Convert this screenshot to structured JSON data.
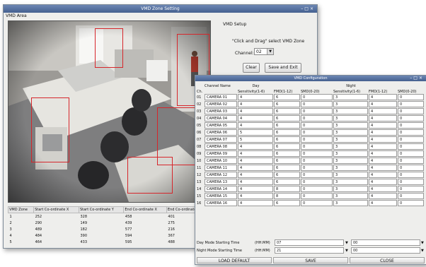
{
  "zone_window": {
    "title": "VMD Zone Setting",
    "menu": "VMD Area",
    "setup": {
      "group_title": "VMD Setup",
      "hint": "\"Click and Drag\" select VMD Zone",
      "channel_label": "Channel:",
      "channel_value": "02",
      "clear_label": "Clear",
      "save_exit_label": "Save and Exit"
    },
    "zone_table": {
      "headers": [
        "VMD Zone",
        "Start Co-ordinate X",
        "Start Co-ordinate Y",
        "End Co-ordinate X",
        "End Co-ordinate Y"
      ],
      "rows": [
        [
          "1",
          "252",
          "328",
          "458",
          "401"
        ],
        [
          "2",
          "290",
          "149",
          "439",
          "275"
        ],
        [
          "3",
          "489",
          "182",
          "577",
          "216"
        ],
        [
          "4",
          "484",
          "390",
          "594",
          "367"
        ],
        [
          "5",
          "464",
          "433",
          "595",
          "488"
        ]
      ]
    }
  },
  "config_window": {
    "title": "VMD Configuration",
    "headers": {
      "ch": "Ch.",
      "channel_name": "Channel Name",
      "day": "Day",
      "night": "Night",
      "day_sens": "Sensitivity(1-6)",
      "day_fmd": "FMD(1-12)",
      "day_smd": "SMD(0-20)",
      "night_sens": "Sensitivity(1-6)",
      "night_fmd": "FMD(1-12)",
      "night_smd": "SMD(0-20)"
    },
    "rows": [
      [
        "01",
        "CAMERA 01",
        "4",
        "6",
        "0",
        "3",
        "4",
        "0"
      ],
      [
        "02",
        "CAMERA 02",
        "4",
        "6",
        "0",
        "3",
        "4",
        "0"
      ],
      [
        "03",
        "CAMERA 03",
        "4",
        "6",
        "0",
        "3",
        "4",
        "0"
      ],
      [
        "04",
        "CAMERA 04",
        "4",
        "6",
        "0",
        "3",
        "4",
        "0"
      ],
      [
        "05",
        "CAMERA 05",
        "4",
        "6",
        "0",
        "3",
        "4",
        "0"
      ],
      [
        "06",
        "CAMERA 06",
        "5",
        "6",
        "0",
        "3",
        "4",
        "0"
      ],
      [
        "07",
        "CAMERA 07",
        "5",
        "6",
        "0",
        "3",
        "4",
        "0"
      ],
      [
        "08",
        "CAMERA 08",
        "4",
        "6",
        "0",
        "3",
        "4",
        "0"
      ],
      [
        "09",
        "CAMERA 09",
        "4",
        "6",
        "0",
        "3",
        "4",
        "0"
      ],
      [
        "10",
        "CAMERA 10",
        "4",
        "6",
        "0",
        "3",
        "4",
        "0"
      ],
      [
        "11",
        "CAMERA 11",
        "4",
        "6",
        "0",
        "3",
        "4",
        "0"
      ],
      [
        "12",
        "CAMERA 12",
        "4",
        "6",
        "0",
        "3",
        "4",
        "0"
      ],
      [
        "13",
        "CAMERA 13",
        "4",
        "6",
        "0",
        "3",
        "4",
        "0"
      ],
      [
        "14",
        "CAMERA 14",
        "4",
        "8",
        "0",
        "3",
        "4",
        "0"
      ],
      [
        "15",
        "CAMERA 15",
        "4",
        "8",
        "0",
        "3",
        "4",
        "0"
      ],
      [
        "16",
        "CAMERA 16",
        "4",
        "6",
        "0",
        "3",
        "4",
        "0"
      ]
    ],
    "day_mode": {
      "label": "Day Mode Starting Time",
      "unit": "(HH:MM)",
      "hh": "07",
      "mm": "00"
    },
    "night_mode": {
      "label": "Night Mode Starting Time",
      "unit": "(HH:MM)",
      "hh": "21",
      "mm": "00"
    },
    "buttons": {
      "load_default": "LOAD DEFAULT",
      "save": "SAVE",
      "close": "CLOSE"
    }
  }
}
